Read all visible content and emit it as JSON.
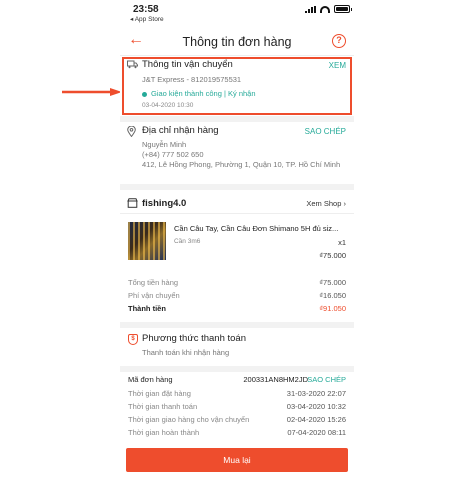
{
  "status_bar": {
    "time": "23:58",
    "back_app": "◂ App Store"
  },
  "header": {
    "title": "Thông tin đơn hàng",
    "help_icon": "?"
  },
  "shipping": {
    "title": "Thông tin vận chuyển",
    "action": "XEM",
    "carrier": "J&T Express - 812019575531",
    "status": "Giao kiện thành công | Ký nhận",
    "timestamp": "03-04-2020 10:30"
  },
  "address": {
    "title": "Địa chỉ nhận hàng",
    "action": "SAO CHÉP",
    "name": "Nguyễn  Minh",
    "phone": "(+84) 777 502 650",
    "line": "412, Lê Hồng Phong, Phường 1, Quận 10, TP. Hồ Chí Minh"
  },
  "shop": {
    "name": "fishing4.0",
    "action": "Xem Shop",
    "product": {
      "name": "Cần Câu Tay, Cần Câu Đơn Shimano 5H đủ siz...",
      "variant": "Cần 3m6",
      "qty": "x1",
      "price": "₫75.000"
    }
  },
  "totals": {
    "items_label": "Tổng tiền hàng",
    "items_value": "₫75.000",
    "shipping_label": "Phí vận chuyển",
    "shipping_value": "₫16.050",
    "total_label": "Thành tiền",
    "total_value": "₫91.050"
  },
  "payment": {
    "title": "Phương thức thanh toán",
    "method": "Thanh toán khi nhận hàng"
  },
  "order_info": {
    "code_label": "Mã đơn hàng",
    "code_value": "200331AN8HM2JD",
    "copy": "SAO CHÉP",
    "rows": [
      {
        "label": "Thời gian đặt hàng",
        "value": "31-03-2020 22:07"
      },
      {
        "label": "Thời gian thanh toán",
        "value": "03-04-2020 10:32"
      },
      {
        "label": "Thời gian giao hàng cho vận chuyển",
        "value": "02-04-2020 15:26"
      },
      {
        "label": "Thời gian hoàn thành",
        "value": "07-04-2020 08:11"
      }
    ]
  },
  "button": {
    "label": "Mua lại"
  },
  "colors": {
    "accent": "#ee4d2d",
    "teal": "#26aa99"
  }
}
